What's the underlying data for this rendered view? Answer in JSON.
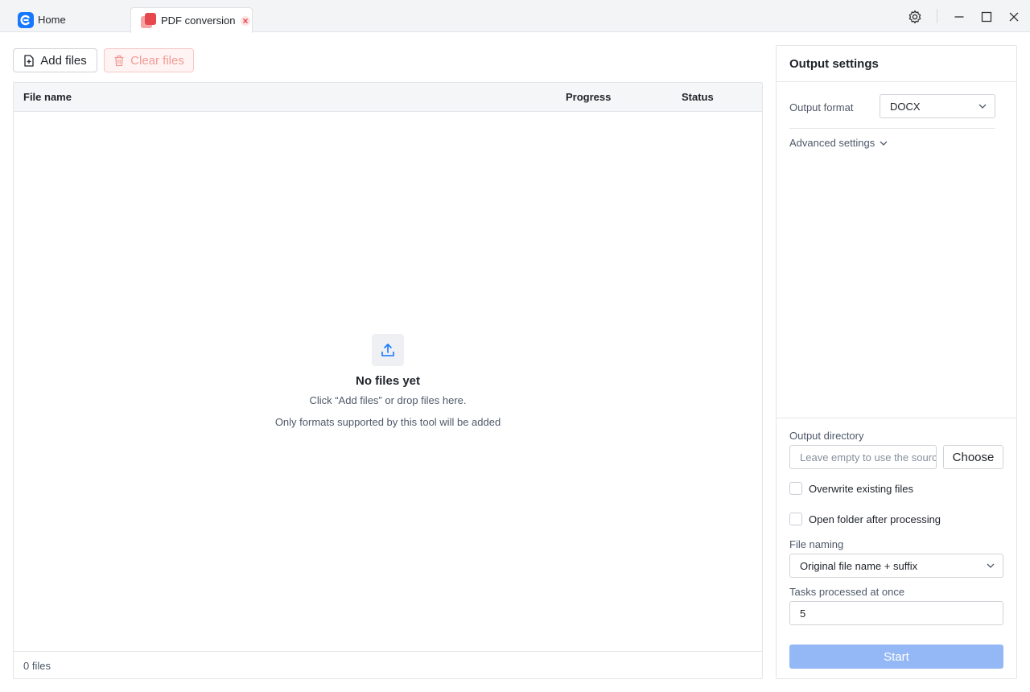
{
  "tabs": {
    "home_label": "Home",
    "active_label": "PDF conversion"
  },
  "toolbar": {
    "add_label": "Add files",
    "clear_label": "Clear files"
  },
  "table": {
    "columns": [
      "File name",
      "Progress",
      "Status"
    ],
    "empty_title": "No files yet",
    "empty_line1": "Click “Add files” or drop files here.",
    "empty_line2": "Only formats supported by this tool will be added",
    "footer_count": "0 files"
  },
  "settings": {
    "title": "Output settings",
    "format_label": "Output format",
    "format_value": "DOCX",
    "advanced_label": "Advanced settings",
    "directory_label": "Output directory",
    "directory_placeholder": "Leave empty to use the source folder",
    "choose_label": "Choose",
    "overwrite_label": "Overwrite existing files",
    "open_folder_label": "Open folder after processing",
    "naming_label": "File naming",
    "naming_value": "Original file name + suffix",
    "tasks_label": "Tasks processed at once",
    "tasks_value": "5",
    "start_label": "Start"
  },
  "colors": {
    "accent": "#1677ff",
    "start_disabled": "#93b8f5",
    "danger": "#e5484d"
  },
  "icons": [
    "app-logo-icon",
    "pdf-icon",
    "close-icon",
    "gear-icon",
    "minimize-icon",
    "maximize-icon",
    "add-file-icon",
    "trash-icon",
    "upload-icon",
    "chevron-down-icon"
  ]
}
